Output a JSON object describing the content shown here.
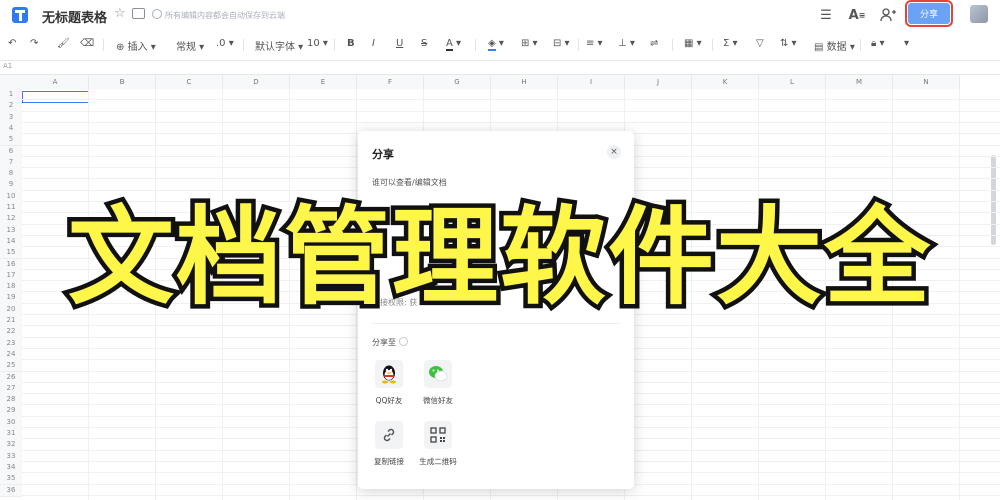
{
  "titlebar": {
    "doc_title": "无标题表格",
    "save_status": "所有编辑内容都会自动保存到云端",
    "share_label": "分享"
  },
  "toolbar": {
    "insert": "插入",
    "format_normal": "常规",
    "decimal": ".0",
    "font": "默认字体",
    "font_size": "10",
    "data": "数据"
  },
  "formula_bar": {
    "cell_ref": "A1"
  },
  "sheet": {
    "columns": [
      "A",
      "B",
      "C",
      "D",
      "E",
      "F",
      "G",
      "H",
      "I",
      "J",
      "K",
      "L",
      "M",
      "N"
    ],
    "rows": [
      "1",
      "2",
      "3",
      "4",
      "5",
      "6",
      "7",
      "8",
      "9",
      "10",
      "11",
      "12",
      "13",
      "14",
      "15",
      "16",
      "17",
      "18",
      "19",
      "20",
      "21",
      "22",
      "23",
      "24",
      "25",
      "26",
      "27",
      "28",
      "29",
      "30",
      "31",
      "32",
      "33",
      "34",
      "35",
      "36"
    ]
  },
  "modal": {
    "title": "分享",
    "close": "×",
    "permission_text": "谁可以查看/编辑文档",
    "permission_detail": "链接权限: 获",
    "share_to": "分享至",
    "options": [
      "QQ好友",
      "微信好友",
      "复制链接",
      "生成二维码"
    ]
  },
  "overlay": {
    "banner_text": "文档管理软件大全"
  },
  "colors": {
    "accent": "#6aa3f5",
    "highlight": "#e0463a",
    "banner": "#fff64a"
  }
}
